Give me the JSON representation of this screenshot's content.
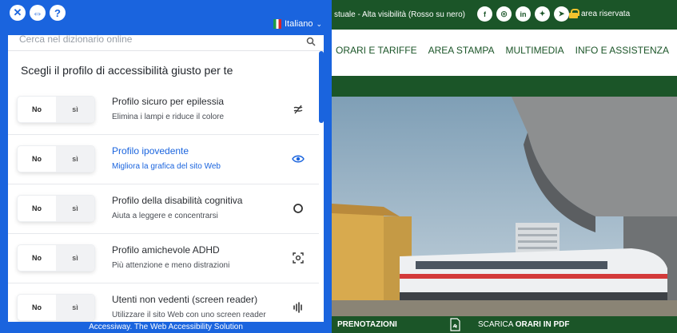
{
  "site": {
    "accessibility_text": "stuale - Alta visibilità (Rosso su nero)",
    "social_icons": [
      "facebook-icon",
      "instagram-icon",
      "linkedin-icon",
      "twitter-icon",
      "telegram-icon"
    ],
    "reserved_area": "area riservata",
    "nav": [
      "ORARI E TARIFFE",
      "AREA STAMPA",
      "MULTIMEDIA",
      "INFO E ASSISTENZA"
    ],
    "bottom": {
      "prenotazioni": "PRENOTAZIONI",
      "orari_prefix": "SCARICA",
      "orari_bold": "ORARI IN PDF"
    },
    "colors": {
      "brand_green": "#1b5528"
    }
  },
  "panel": {
    "header_icons": [
      "close-icon",
      "move-icon",
      "help-icon"
    ],
    "language": "Italiano",
    "search_placeholder": "Cerca nel dizionario online",
    "heading": "Scegli il profilo di accessibilità giusto per te",
    "profiles": [
      {
        "title": "Profilo sicuro per epilessia",
        "desc": "Elimina i lampi e riduce il colore",
        "icon": "no-flash-icon",
        "off": "No",
        "on": "sì",
        "active": false
      },
      {
        "title": "Profilo ipovedente",
        "desc": "Migliora la grafica del sito Web",
        "icon": "eye-icon",
        "off": "No",
        "on": "sì",
        "active": true
      },
      {
        "title": "Profilo della disabilità cognitiva",
        "desc": "Aiuta a leggere e concentrarsi",
        "icon": "circle-icon",
        "off": "No",
        "on": "sì",
        "active": false
      },
      {
        "title": "Profilo amichevole ADHD",
        "desc": "Più attenzione e meno distrazioni",
        "icon": "focus-icon",
        "off": "No",
        "on": "sì",
        "active": false
      },
      {
        "title": "Utenti non vedenti (screen reader)",
        "desc": "Utilizzare il sito Web con uno screen reader",
        "icon": "audio-icon",
        "off": "No",
        "on": "sì",
        "active": false
      }
    ],
    "footer": "Accessiway. The Web Accessibility Solution",
    "colors": {
      "accent": "#1a64de"
    }
  }
}
